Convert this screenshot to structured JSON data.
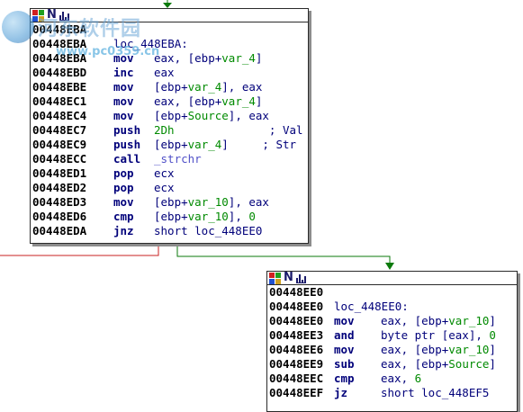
{
  "colors": {
    "edge_green": "#0b7a0b",
    "edge_red": "#c82020",
    "edge_blue": "#1d5fd6",
    "address": "#000000",
    "mnemonic": "#00007a",
    "variable": "#008a00",
    "function": "#5050c8"
  },
  "header_icons": [
    "grid-icon",
    "n-icon",
    "bar-chart-icon"
  ],
  "watermark": {
    "text": "河东软件园",
    "url": "www.pc0359.cn"
  },
  "node1": {
    "lines": [
      {
        "addr": "00448EBA",
        "mn": "",
        "ops": [],
        "cmt": ""
      },
      {
        "addr": "00448EBA",
        "label": "loc_448EBA:"
      },
      {
        "addr": "00448EBA",
        "mn": "mov",
        "ops": [
          {
            "t": "eax, [ebp+",
            "c": "op"
          },
          {
            "t": "var_4",
            "c": "var"
          },
          {
            "t": "]",
            "c": "op"
          }
        ]
      },
      {
        "addr": "00448EBD",
        "mn": "inc",
        "ops": [
          {
            "t": "eax",
            "c": "op"
          }
        ]
      },
      {
        "addr": "00448EBE",
        "mn": "mov",
        "ops": [
          {
            "t": "[ebp+",
            "c": "op"
          },
          {
            "t": "var_4",
            "c": "var"
          },
          {
            "t": "], eax",
            "c": "op"
          }
        ]
      },
      {
        "addr": "00448EC1",
        "mn": "mov",
        "ops": [
          {
            "t": "eax, [ebp+",
            "c": "op"
          },
          {
            "t": "var_4",
            "c": "var"
          },
          {
            "t": "]",
            "c": "op"
          }
        ]
      },
      {
        "addr": "00448EC4",
        "mn": "mov",
        "ops": [
          {
            "t": "[ebp+",
            "c": "op"
          },
          {
            "t": "Source",
            "c": "var"
          },
          {
            "t": "], eax",
            "c": "op"
          }
        ]
      },
      {
        "addr": "00448EC7",
        "mn": "push",
        "ops": [
          {
            "t": "2Dh",
            "c": "num"
          },
          {
            "t": "              ; Val",
            "c": "cm"
          }
        ]
      },
      {
        "addr": "00448EC9",
        "mn": "push",
        "ops": [
          {
            "t": "[ebp+",
            "c": "op"
          },
          {
            "t": "var_4",
            "c": "var"
          },
          {
            "t": "]     ; Str",
            "c": "op"
          }
        ]
      },
      {
        "addr": "00448ECC",
        "mn": "call",
        "ops": [
          {
            "t": "_strchr",
            "c": "fn"
          }
        ]
      },
      {
        "addr": "00448ED1",
        "mn": "pop",
        "ops": [
          {
            "t": "ecx",
            "c": "op"
          }
        ]
      },
      {
        "addr": "00448ED2",
        "mn": "pop",
        "ops": [
          {
            "t": "ecx",
            "c": "op"
          }
        ]
      },
      {
        "addr": "00448ED3",
        "mn": "mov",
        "ops": [
          {
            "t": "[ebp+",
            "c": "op"
          },
          {
            "t": "var_10",
            "c": "var"
          },
          {
            "t": "], eax",
            "c": "op"
          }
        ]
      },
      {
        "addr": "00448ED6",
        "mn": "cmp",
        "ops": [
          {
            "t": "[ebp+",
            "c": "op"
          },
          {
            "t": "var_10",
            "c": "var"
          },
          {
            "t": "], ",
            "c": "op"
          },
          {
            "t": "0",
            "c": "num"
          }
        ]
      },
      {
        "addr": "00448EDA",
        "mn": "jnz",
        "ops": [
          {
            "t": "short loc_448EE0",
            "c": "op"
          }
        ]
      }
    ]
  },
  "node2": {
    "lines": [
      {
        "addr": "00448EE0",
        "mn": "",
        "ops": []
      },
      {
        "addr": "00448EE0",
        "label": "loc_448EE0:"
      },
      {
        "addr": "00448EE0",
        "mn": "mov",
        "ops": [
          {
            "t": "eax, [ebp+",
            "c": "op"
          },
          {
            "t": "var_10",
            "c": "var"
          },
          {
            "t": "]",
            "c": "op"
          }
        ]
      },
      {
        "addr": "00448EE3",
        "mn": "and",
        "ops": [
          {
            "t": "byte ptr [eax], ",
            "c": "op"
          },
          {
            "t": "0",
            "c": "num"
          }
        ]
      },
      {
        "addr": "00448EE6",
        "mn": "mov",
        "ops": [
          {
            "t": "eax, [ebp+",
            "c": "op"
          },
          {
            "t": "var_10",
            "c": "var"
          },
          {
            "t": "]",
            "c": "op"
          }
        ]
      },
      {
        "addr": "00448EE9",
        "mn": "sub",
        "ops": [
          {
            "t": "eax, [ebp+",
            "c": "op"
          },
          {
            "t": "Source",
            "c": "var"
          },
          {
            "t": "]",
            "c": "op"
          }
        ]
      },
      {
        "addr": "00448EEC",
        "mn": "cmp",
        "ops": [
          {
            "t": "eax, ",
            "c": "op"
          },
          {
            "t": "6",
            "c": "num"
          }
        ]
      },
      {
        "addr": "00448EEF",
        "mn": "jz",
        "ops": [
          {
            "t": "short loc_448EF5",
            "c": "op"
          }
        ]
      }
    ]
  }
}
